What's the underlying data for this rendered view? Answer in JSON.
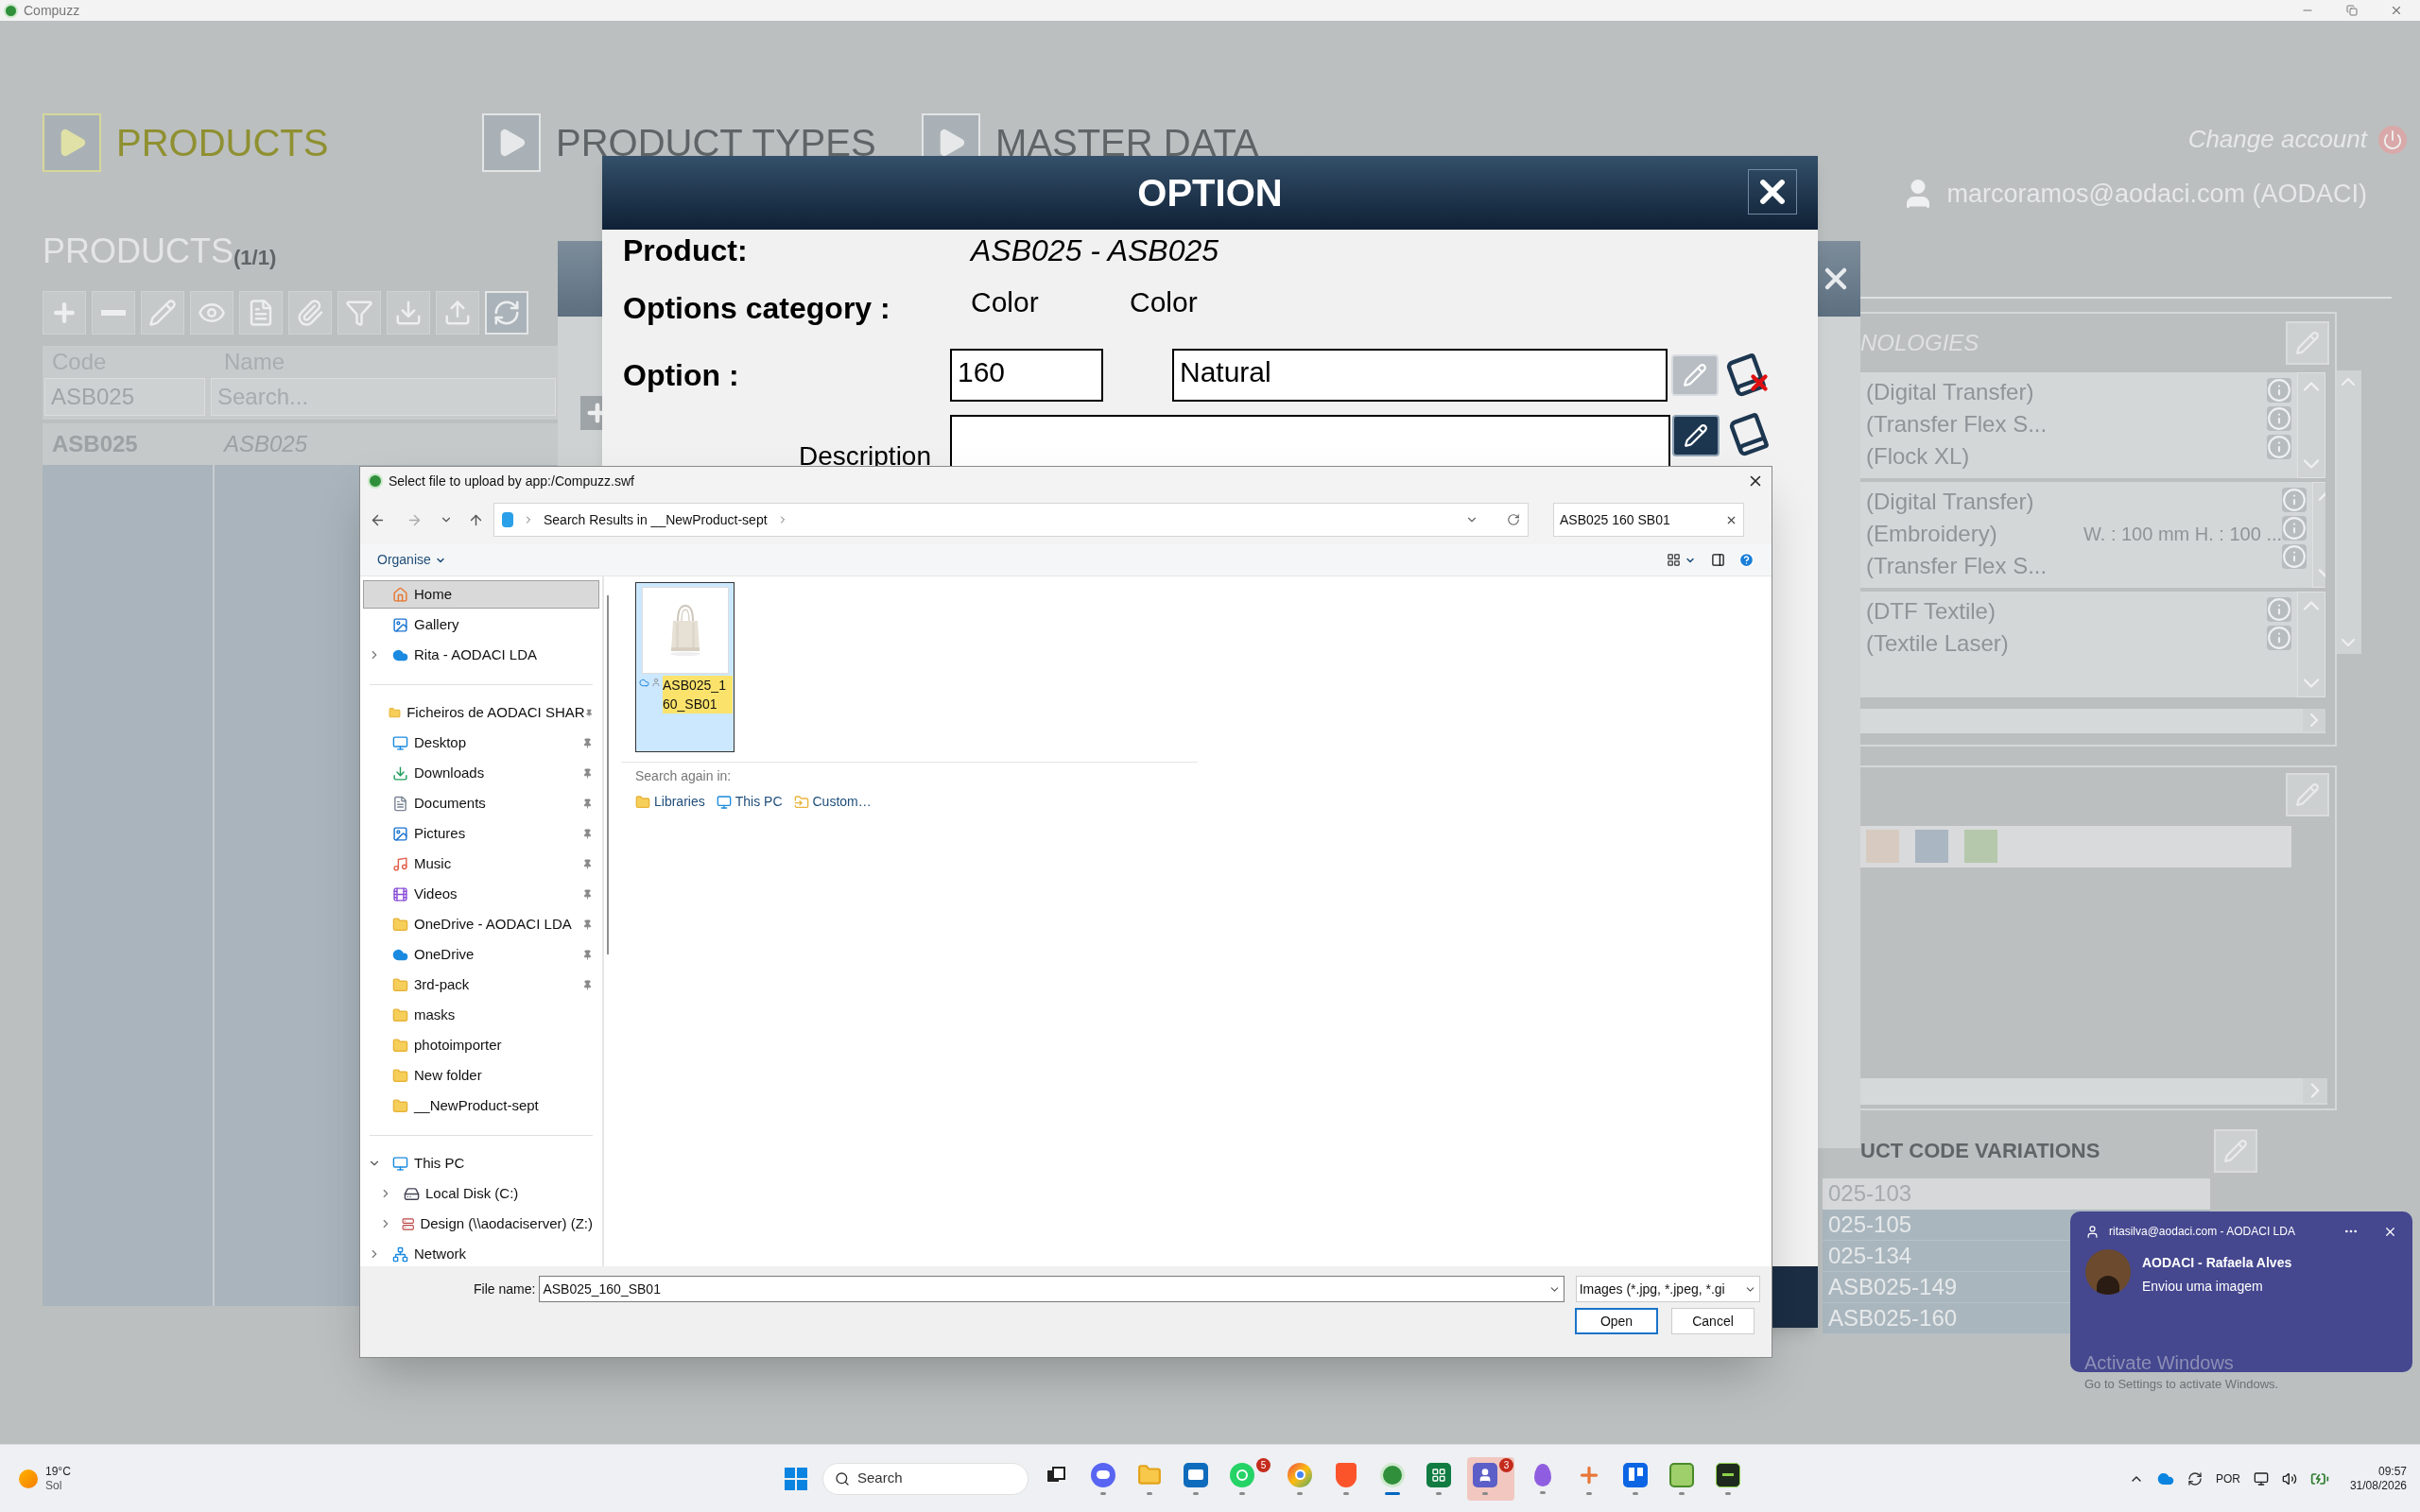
{
  "app": {
    "title": "Compuzz"
  },
  "nav_tabs": [
    {
      "label": "PRODUCTS",
      "selected": true
    },
    {
      "label": "PRODUCT TYPES",
      "selected": false
    },
    {
      "label": "MASTER DATA",
      "selected": false
    }
  ],
  "account": {
    "change_account": "Change account",
    "user": "marcoramos@aodaci.com (AODACI)"
  },
  "products": {
    "title": "PRODUCTS",
    "count": "(1/1)",
    "columns": [
      "Code",
      "Name"
    ],
    "code_filter": "ASB025",
    "name_placeholder": "Search...",
    "rows": [
      {
        "code": "ASB025",
        "name": "ASB025"
      }
    ]
  },
  "technologies": {
    "title": "NOLOGIES",
    "groups": [
      {
        "lines": [
          {
            "text": "(Digital Transfer)"
          },
          {
            "text": "(Transfer Flex S..."
          },
          {
            "text": "(Flock XL)"
          }
        ]
      },
      {
        "lines": [
          {
            "text": "(Digital Transfer)"
          },
          {
            "text": "(Embroidery)",
            "detail": "W. : 100 mm H. : 100 ..."
          },
          {
            "text": "(Transfer Flex S..."
          }
        ]
      },
      {
        "lines": [
          {
            "text": "(DTF Textile)"
          },
          {
            "text": "(Textile Laser)"
          }
        ]
      }
    ]
  },
  "colors": {
    "swatches": [
      {
        "color": "#d7cbc1"
      },
      {
        "color": "#aab6c2"
      },
      {
        "color": "#b5c8ab"
      }
    ]
  },
  "variations": {
    "title": "UCT CODE VARIATIONS",
    "rows": [
      {
        "code": "025-103",
        "selected": true
      },
      {
        "code": "025-105",
        "selected": false
      },
      {
        "code": "025-134",
        "selected": false
      },
      {
        "code": "ASB025-149",
        "selected": false
      },
      {
        "code": "ASB025-160",
        "selected": false
      }
    ]
  },
  "option_dialog": {
    "title": "OPTION",
    "product_label": "Product:",
    "product_value": "ASB025 - ASB025",
    "category_label": "Options category :",
    "category_values": [
      "Color",
      "Color"
    ],
    "option_row": {
      "label": "Option :",
      "code": "160",
      "name": "Natural",
      "edit_active": false
    },
    "description_row": {
      "label": "Description",
      "edit_active": true
    }
  },
  "file_dialog": {
    "title": "Select file to upload by app:/Compuzz.swf",
    "address": "Search Results in __NewProduct-sept",
    "search": "ASB025 160 SB01",
    "organise": "Organise",
    "nav_sections": [
      {
        "items": [
          {
            "label": "Home",
            "kind": "home",
            "selected": true,
            "pinned": false
          },
          {
            "label": "Gallery",
            "kind": "gallery",
            "selected": false,
            "pinned": false
          },
          {
            "label": "Rita - AODACI LDA",
            "kind": "cloud",
            "selected": false,
            "pinned": false,
            "expanded": false
          }
        ]
      },
      {
        "items": [
          {
            "label": "Ficheiros de AODACI SHAR",
            "kind": "shared",
            "selected": false,
            "pinned": true
          },
          {
            "label": "Desktop",
            "kind": "desktop",
            "selected": false,
            "pinned": true
          },
          {
            "label": "Downloads",
            "kind": "downloads",
            "selected": false,
            "pinned": true
          },
          {
            "label": "Documents",
            "kind": "documents",
            "selected": false,
            "pinned": true
          },
          {
            "label": "Pictures",
            "kind": "pictures",
            "selected": false,
            "pinned": true
          },
          {
            "label": "Music",
            "kind": "music",
            "selected": false,
            "pinned": true
          },
          {
            "label": "Videos",
            "kind": "videos",
            "selected": false,
            "pinned": true
          },
          {
            "label": "OneDrive - AODACI LDA",
            "kind": "folder",
            "selected": false,
            "pinned": true
          },
          {
            "label": "OneDrive",
            "kind": "cloud",
            "selected": false,
            "pinned": true
          },
          {
            "label": "3rd-pack",
            "kind": "folder",
            "selected": false,
            "pinned": true
          },
          {
            "label": "masks",
            "kind": "folder",
            "selected": false,
            "pinned": false
          },
          {
            "label": "photoimporter",
            "kind": "folder",
            "selected": false,
            "pinned": false
          },
          {
            "label": "New folder",
            "kind": "folder",
            "selected": false,
            "pinned": false
          },
          {
            "label": "__NewProduct-sept",
            "kind": "folder",
            "selected": false,
            "pinned": false
          }
        ]
      },
      {
        "items": [
          {
            "label": "This PC",
            "kind": "pc",
            "selected": false,
            "pinned": false,
            "expanded": true,
            "children": [
              {
                "label": "Local Disk (C:)",
                "kind": "disk",
                "selected": false,
                "pinned": false,
                "expanded": false
              },
              {
                "label": "Design (\\\\aodaciserver) (Z:)",
                "kind": "netdrive",
                "selected": false,
                "pinned": false,
                "expanded": false
              }
            ]
          },
          {
            "label": "Network",
            "kind": "network",
            "selected": false,
            "pinned": false,
            "expanded": false
          }
        ]
      }
    ],
    "files": [
      {
        "name": "ASB025_160_SB01",
        "selected": true,
        "kind": "picture"
      }
    ],
    "search_again_label": "Search again in:",
    "search_again": [
      {
        "label": "Libraries",
        "kind": "folder"
      },
      {
        "label": "This PC",
        "kind": "pc"
      },
      {
        "label": "Custom…",
        "kind": "custom"
      }
    ],
    "file_name_label": "File name:",
    "file_name": "ASB025_160_SB01",
    "file_type": "Images (*.jpg, *.jpeg, *.gi",
    "buttons": [
      "Open",
      "Cancel"
    ]
  },
  "notification": {
    "account": "ritasilva@aodaci.com - AODACI LDA",
    "title": "AODACI - Rafaela Alves",
    "body": "Enviou uma imagem"
  },
  "activation": {
    "title": "Activate Windows",
    "subtitle": "Go to Settings to activate Windows."
  },
  "taskbar": {
    "temperature": "19°C",
    "condition": "Sol",
    "search": "Search",
    "apps": [
      {
        "kind": "taskview",
        "running": false,
        "focused": false,
        "attention": false
      },
      {
        "kind": "chat",
        "running": true,
        "focused": false,
        "attention": false
      },
      {
        "kind": "folder",
        "running": true,
        "focused": false,
        "attention": false
      },
      {
        "kind": "mail",
        "running": true,
        "focused": false,
        "attention": false
      },
      {
        "kind": "phone",
        "running": true,
        "focused": false,
        "attention": false,
        "badge": "5"
      },
      {
        "kind": "browser",
        "running": true,
        "focused": false,
        "attention": false
      },
      {
        "kind": "shield",
        "running": true,
        "focused": false,
        "attention": false
      },
      {
        "kind": "gear",
        "running": true,
        "focused": true,
        "attention": false
      },
      {
        "kind": "sheet",
        "running": true,
        "focused": false,
        "attention": false
      },
      {
        "kind": "people",
        "running": true,
        "focused": false,
        "attention": true,
        "badge": "3"
      },
      {
        "kind": "drop",
        "running": true,
        "focused": false,
        "attention": false
      },
      {
        "kind": "burst",
        "running": true,
        "focused": false,
        "attention": false
      },
      {
        "kind": "board",
        "running": true,
        "focused": false,
        "attention": false
      },
      {
        "kind": "note",
        "running": true,
        "focused": false,
        "attention": false
      },
      {
        "kind": "terminal",
        "running": true,
        "focused": false,
        "attention": false
      }
    ],
    "language": "POR",
    "time": "09:57",
    "date": "31/08/2026"
  }
}
